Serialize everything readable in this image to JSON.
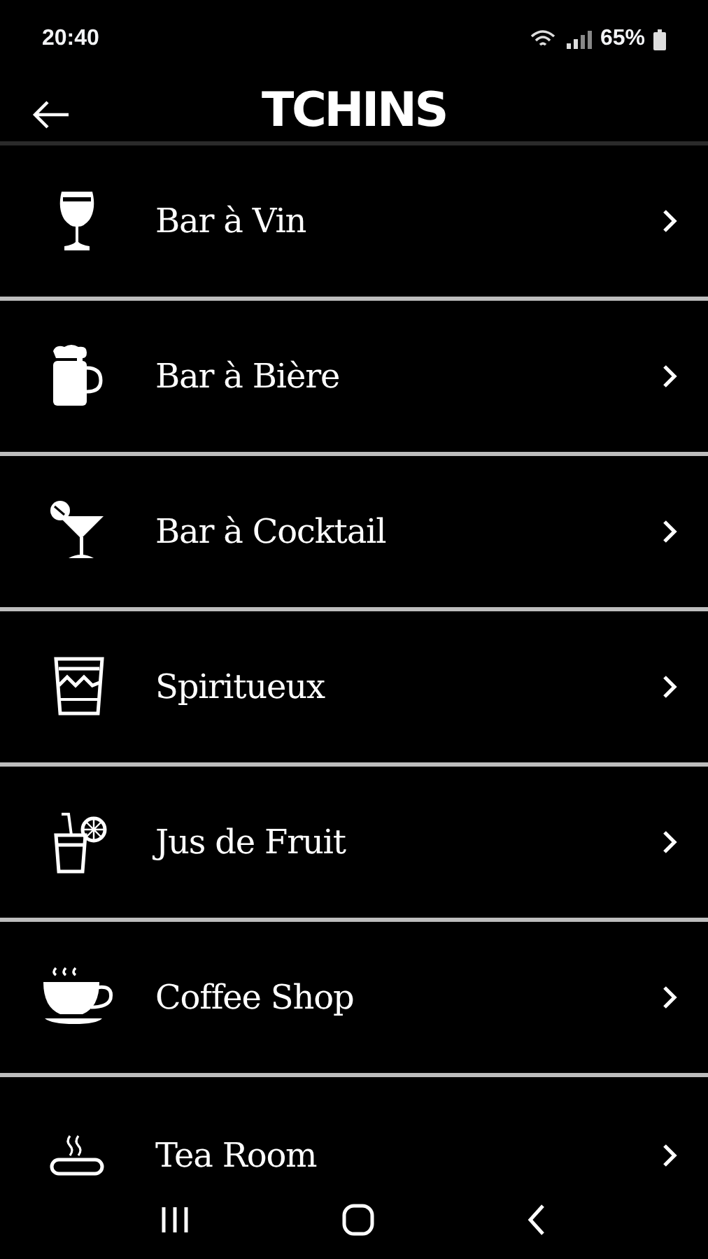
{
  "status_bar": {
    "time": "20:40",
    "battery": "65%"
  },
  "header": {
    "logo": "TCHINS"
  },
  "categories": [
    {
      "label": "Bar à Vin",
      "kind": "wine"
    },
    {
      "label": "Bar à Bière",
      "kind": "beer"
    },
    {
      "label": "Bar à Cocktail",
      "kind": "cocktail"
    },
    {
      "label": "Spiritueux",
      "kind": "spirits"
    },
    {
      "label": "Jus de Fruit",
      "kind": "juice"
    },
    {
      "label": "Coffee Shop",
      "kind": "coffee"
    },
    {
      "label": "Tea Room",
      "kind": "tea"
    }
  ]
}
